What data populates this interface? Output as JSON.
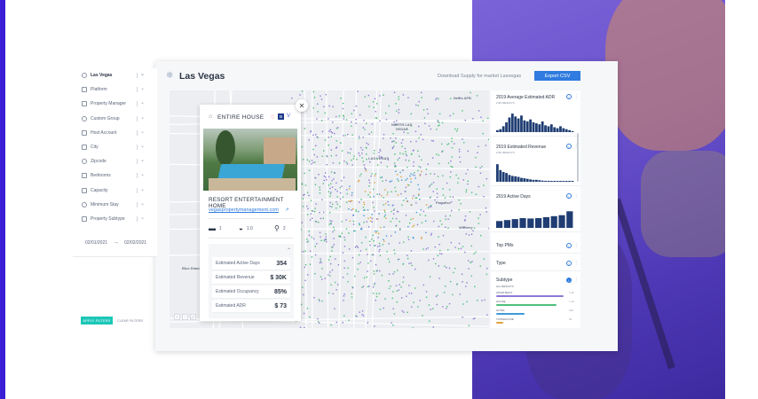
{
  "filters": {
    "items": [
      {
        "label": "Las Vegas",
        "icon": "location-icon",
        "active": true
      },
      {
        "label": "Platform",
        "icon": "platform-icon"
      },
      {
        "label": "Property Manager",
        "icon": "property-manager-icon"
      },
      {
        "label": "Custom Group",
        "icon": "group-icon"
      },
      {
        "label": "Host Account",
        "icon": "host-icon"
      },
      {
        "label": "City",
        "icon": "city-icon"
      },
      {
        "label": "Zipcode",
        "icon": "pin-icon"
      },
      {
        "label": "Bedrooms",
        "icon": "bed-icon"
      },
      {
        "label": "Capacity",
        "icon": "capacity-icon"
      },
      {
        "label": "Minimum Stay",
        "icon": "calendar-icon"
      },
      {
        "label": "Property Subtype",
        "icon": "subtype-icon"
      }
    ],
    "date_from": "02/01/2021",
    "date_to": "02/02/2021",
    "apply_label": "APPLY FILTERS",
    "clear_label": "CLEAR FILTERS"
  },
  "header": {
    "title": "Las Vegas",
    "download_text": "Download Supply for market Lasvegas",
    "export_label": "Export CSV"
  },
  "map": {
    "labels": {
      "north_las_vegas": "NORTH LAS\nVEGAS",
      "las_vegas": "LAS VEGAS",
      "nellis": "Nellis AFB",
      "blue_diamond": "Blue Diamond",
      "whitney": "Whitney",
      "paradise": "Paradise"
    },
    "zoom": [
      "+",
      "−",
      "⤢"
    ],
    "dot_colors": [
      "#4fbf7a",
      "#8f7ad6",
      "#3f9bd8",
      "#e0a23a"
    ]
  },
  "popup": {
    "type": "ENTIRE HOUSE",
    "booking_badge": "B",
    "name": "RESORT ENTERTAINMENT HOME",
    "link": "vegaspropertymanagement.com",
    "bedrooms": "1",
    "bathrooms": "1.0",
    "guests": "2",
    "stats": [
      {
        "key": "Estimated Active Days",
        "value": "354"
      },
      {
        "key": "Estimated Revenue",
        "value": "$ 30K"
      },
      {
        "key": "Estimated Occupancy",
        "value": "85%"
      },
      {
        "key": "Estimated ADR",
        "value": "$ 73"
      }
    ]
  },
  "side": {
    "adr": {
      "title": "2019 Average Estimated ADR",
      "sub": "2.9K RESULTS",
      "bars": [
        0.1,
        0.15,
        0.3,
        0.5,
        0.75,
        0.95,
        0.8,
        0.7,
        0.85,
        0.6,
        0.55,
        0.65,
        0.5,
        0.45,
        0.4,
        0.55,
        0.35,
        0.3,
        0.4,
        0.25,
        0.2,
        0.3,
        0.2,
        0.15,
        0.1,
        0.05
      ]
    },
    "revenue": {
      "title": "2019 Estimated Revenue",
      "sub": "2.9K RESULTS",
      "bars": [
        0.9,
        0.6,
        0.5,
        0.45,
        0.35,
        0.3,
        0.28,
        0.25,
        0.2,
        0.18,
        0.15,
        0.12,
        0.1,
        0.1,
        0.08,
        0.06,
        0.05,
        0.05,
        0.04,
        0.04,
        0.03,
        0.03,
        0.02,
        0.02,
        0.02,
        0.02
      ]
    },
    "active": {
      "title": "2019 Active Days",
      "sub": "2.9K RESULTS",
      "bars": [
        0.35,
        0.4,
        0.45,
        0.5,
        0.48,
        0.5,
        0.55,
        0.6,
        0.65,
        0.85
      ]
    },
    "top_pms": "Top PMs",
    "type": "Type",
    "subtype": {
      "title": "Subtype",
      "sub": "ALL RESULTS",
      "items": [
        {
          "label": "APARTMENT",
          "color": "#8f7ad6",
          "frac": 0.95,
          "count": "1.2K"
        },
        {
          "label": "HOUSE",
          "color": "#4fbf7a",
          "frac": 0.85,
          "count": "1.1K"
        },
        {
          "label": "HOTEL",
          "color": "#3f9bd8",
          "frac": 0.4,
          "count": "320"
        },
        {
          "label": "TOWNHOUSE",
          "color": "#e0a23a",
          "frac": 0.1,
          "count": "54"
        }
      ]
    }
  }
}
